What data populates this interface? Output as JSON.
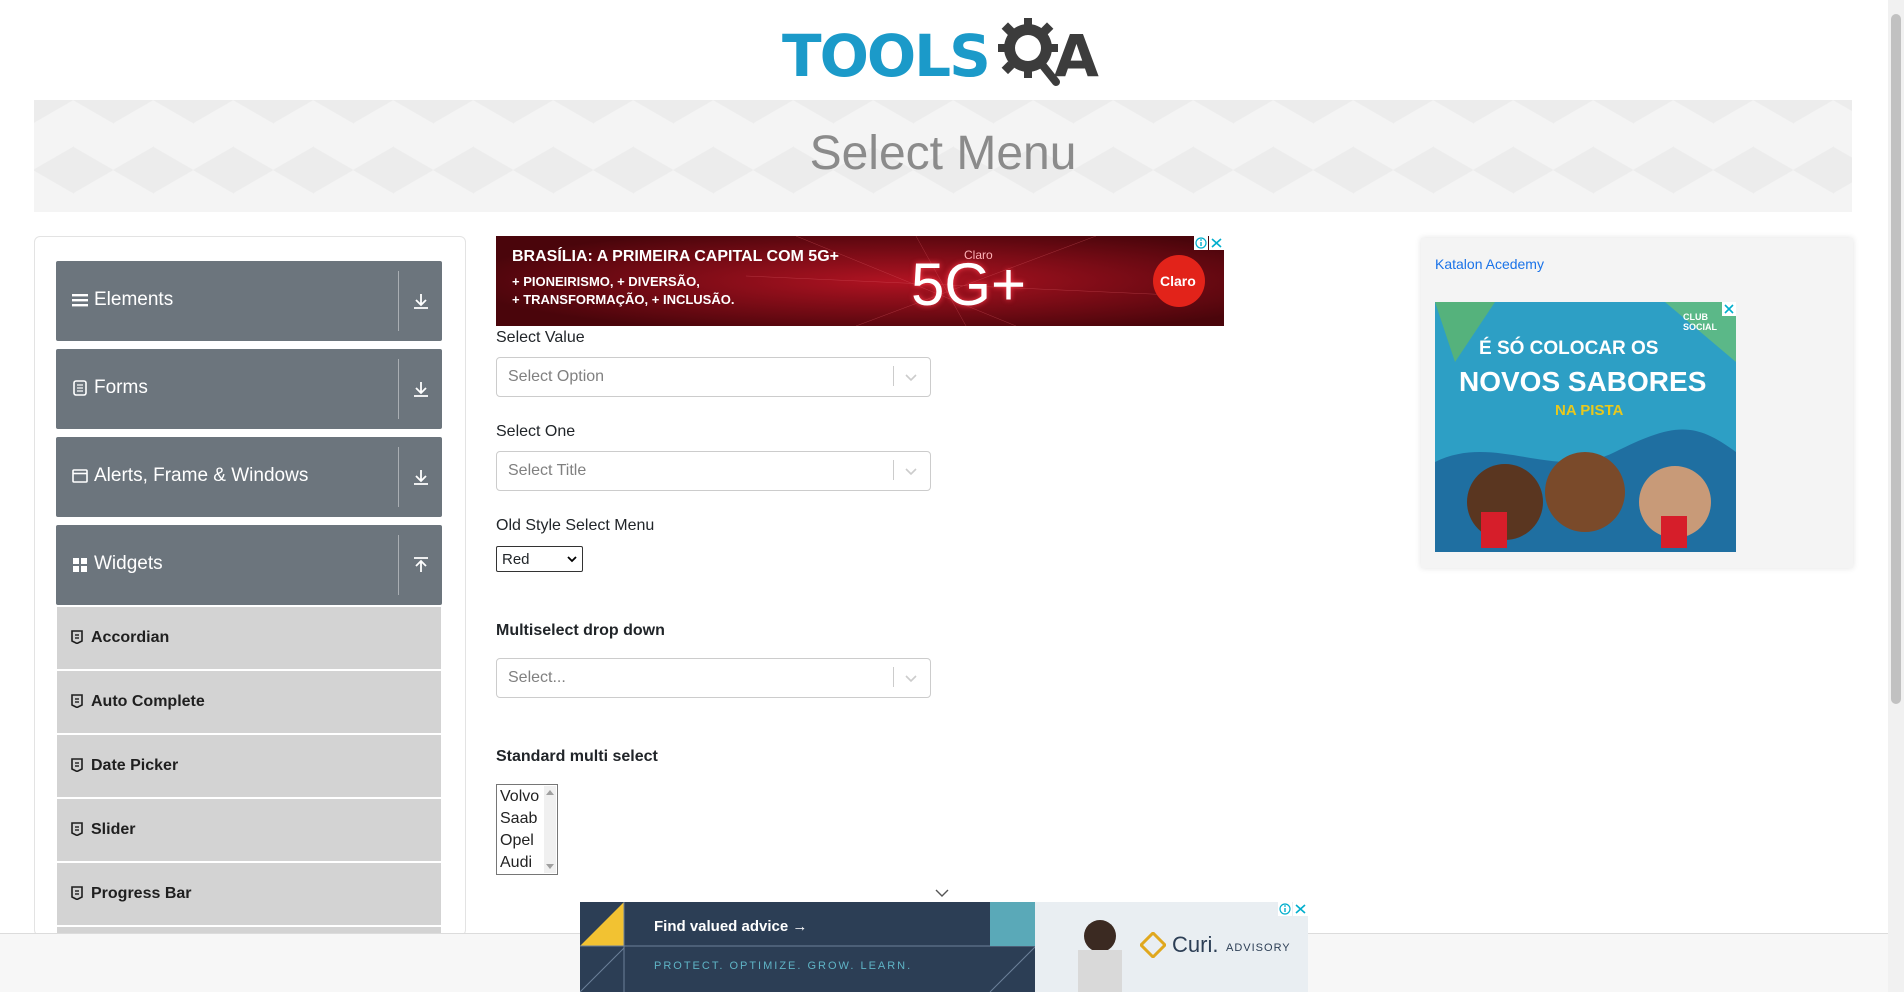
{
  "logo": {
    "text_tools": "TOOLS",
    "text_a": "A",
    "alt": "ToolsQA"
  },
  "page": {
    "title": "Select Menu"
  },
  "sidebar": {
    "groups": [
      {
        "label": "Elements",
        "icon": "menu-icon"
      },
      {
        "label": "Forms",
        "icon": "document-icon"
      },
      {
        "label": "Alerts, Frame & Windows",
        "icon": "window-icon"
      },
      {
        "label": "Widgets",
        "icon": "grid-icon"
      }
    ],
    "widget_items": [
      {
        "label": "Accordian"
      },
      {
        "label": "Auto Complete"
      },
      {
        "label": "Date Picker"
      },
      {
        "label": "Slider"
      },
      {
        "label": "Progress Bar"
      }
    ]
  },
  "top_ad": {
    "headline": "BRASÍLIA: A PRIMEIRA CAPITAL COM 5G+",
    "line1": "+ PIONEIRISMO, + DIVERSÃO,",
    "line2": "+ TRANSFORMAÇÃO, + INCLUSÃO.",
    "badge": "5G+",
    "badge_small": "Claro",
    "brand": "Claro"
  },
  "form": {
    "select_value": {
      "label": "Select Value",
      "placeholder": "Select Option"
    },
    "select_one": {
      "label": "Select One",
      "placeholder": "Select Title"
    },
    "old_style": {
      "label": "Old Style Select Menu",
      "value": "Red"
    },
    "multiselect": {
      "label": "Multiselect drop down",
      "placeholder": "Select..."
    },
    "standard_multi": {
      "label": "Standard multi select",
      "options": [
        "Volvo",
        "Saab",
        "Opel",
        "Audi"
      ]
    }
  },
  "right_ad": {
    "link_text": "Katalon Acedemy",
    "headline1": "É SÓ COLOCAR OS",
    "headline2": "NOVOS SABORES",
    "headline3": "NA PISTA",
    "brand": "CLUB SOCIAL"
  },
  "bottom_ad": {
    "cta": "Find valued advice →",
    "tagline": "PROTECT. OPTIMIZE. GROW. LEARN.",
    "brand": "Curi.",
    "brand_sub": "ADVISORY"
  },
  "colors": {
    "primary_blue": "#1b9ac9",
    "sidebar_group": "#6c757d",
    "sidebar_item": "#d3d3d3",
    "title_gray": "#8b8b8b"
  }
}
